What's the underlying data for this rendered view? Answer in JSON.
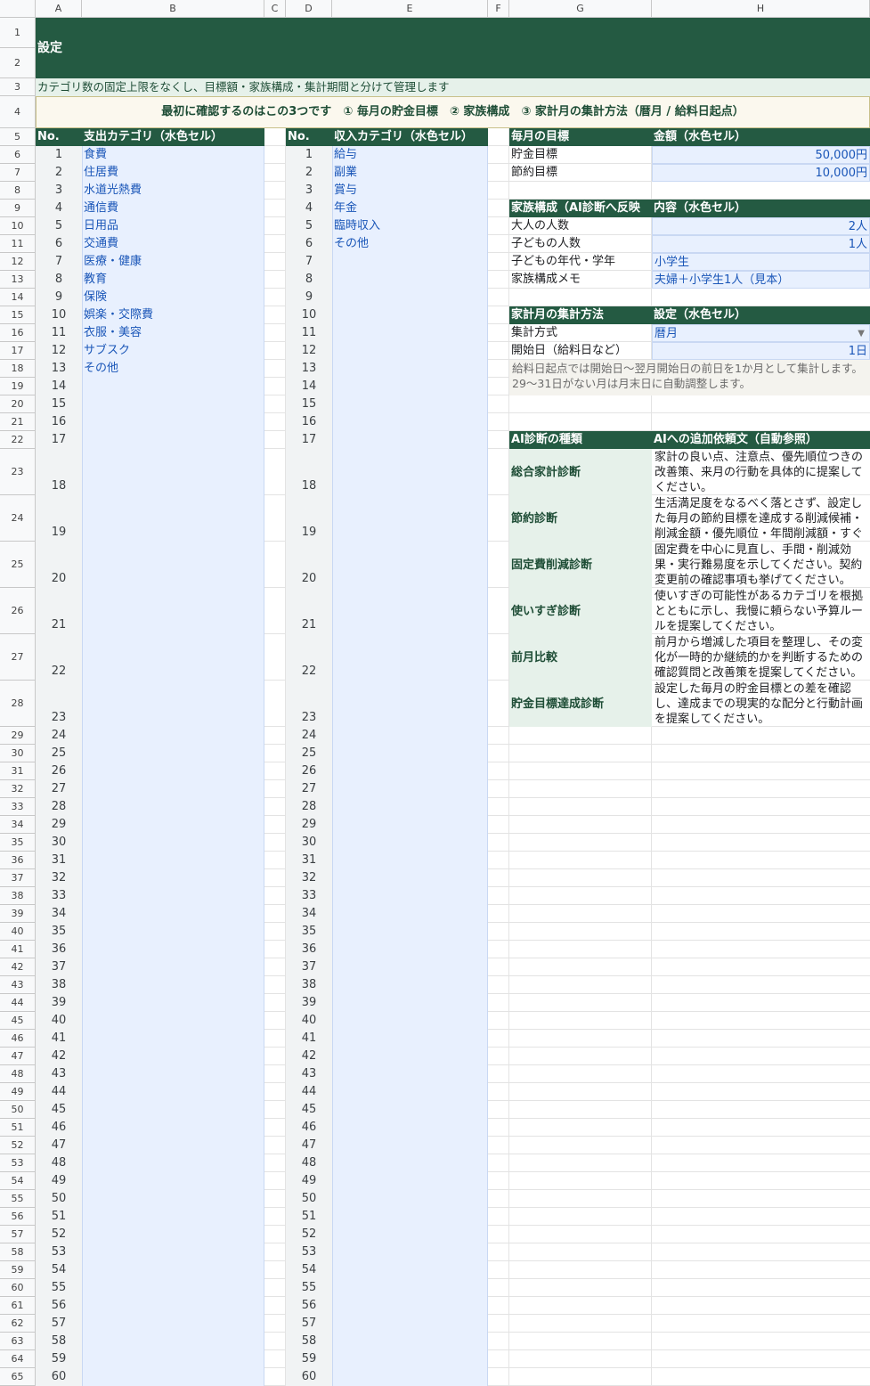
{
  "columns": [
    "A",
    "B",
    "C",
    "D",
    "E",
    "F",
    "G",
    "H"
  ],
  "title": "設定",
  "subtitle": "カテゴリ数の固定上限をなくし、目標額・家族構成・集計期間と分けて管理します",
  "notice": "最初に確認するのはこの3つです　① 毎月の貯金目標　② 家族構成　③ 家計月の集計方法（暦月 / 給料日起点）",
  "expense": {
    "no_header": "No.",
    "header": "支出カテゴリ（水色セル）",
    "items": [
      "食費",
      "住居費",
      "水道光熱費",
      "通信費",
      "日用品",
      "交通費",
      "医療・健康",
      "教育",
      "保険",
      "娯楽・交際費",
      "衣服・美容",
      "サブスク",
      "その他"
    ]
  },
  "income": {
    "no_header": "No.",
    "header": "収入カテゴリ（水色セル）",
    "items": [
      "給与",
      "副業",
      "賞与",
      "年金",
      "臨時収入",
      "その他"
    ]
  },
  "goals": {
    "header_label": "毎月の目標",
    "header_value": "金額（水色セル）",
    "rows": [
      {
        "label": "貯金目標",
        "value": "50,000円"
      },
      {
        "label": "節約目標",
        "value": "10,000円"
      }
    ]
  },
  "family": {
    "header_label": "家族構成（AI診断へ反映",
    "header_value": "内容（水色セル）",
    "rows": [
      {
        "label": "大人の人数",
        "value": "2人"
      },
      {
        "label": "子どもの人数",
        "value": "1人"
      },
      {
        "label": "子どもの年代・学年",
        "value": "小学生"
      },
      {
        "label": "家族構成メモ",
        "value": "夫婦＋小学生1人（見本）"
      }
    ]
  },
  "period": {
    "header_label": "家計月の集計方法",
    "header_value": "設定（水色セル）",
    "method_label": "集計方式",
    "method_value": "暦月",
    "start_label": "開始日（給料日など）",
    "start_value": "1日",
    "note": "給料日起点では開始日〜翌月開始日の前日を1か月として集計します。29〜31日がない月は月末日に自動調整します。"
  },
  "ai": {
    "header_label": "AI診断の種類",
    "header_value": "AIへの追加依頼文（自動参照）",
    "rows": [
      {
        "label": "総合家計診断",
        "text": "家計の良い点、注意点、優先順位つきの改善策、来月の行動を具体的に提案してください。"
      },
      {
        "label": "節約診断",
        "text": "生活満足度をなるべく落とさず、設定した毎月の節約目標を達成する削減候補・削減金額・優先順位・年間削減額・すぐできる改善策を提案してください。"
      },
      {
        "label": "固定費削減診断",
        "text": "固定費を中心に見直し、手間・削減効果・実行難易度を示してください。契約変更前の確認事項も挙げてください。"
      },
      {
        "label": "使いすぎ診断",
        "text": "使いすぎの可能性があるカテゴリを根拠とともに示し、我慢に頼らない予算ルールを提案してください。"
      },
      {
        "label": "前月比較",
        "text": "前月から増減した項目を整理し、その変化が一時的か継続的かを判断するための確認質問と改善策を提案してください。"
      },
      {
        "label": "貯金目標達成診断",
        "text": "設定した毎月の貯金目標との差を確認し、達成までの現実的な配分と行動計画を提案してください。"
      }
    ]
  },
  "colors": {
    "header_green": "#245a42",
    "input_blue": "#e8f0fe",
    "value_blue": "#1a56b8"
  }
}
